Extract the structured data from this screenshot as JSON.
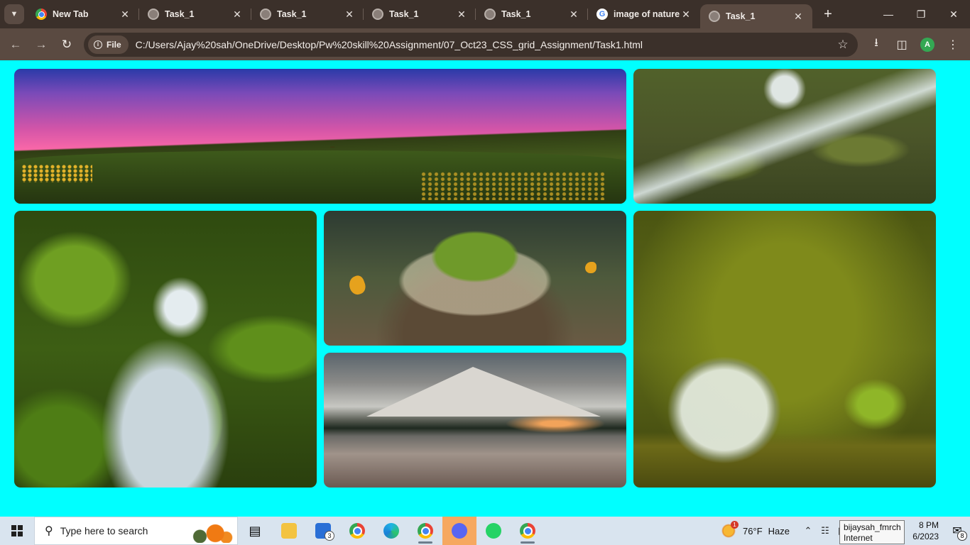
{
  "browser": {
    "tabs": [
      {
        "title": "New Tab",
        "icon": "chrome-icon",
        "active": false
      },
      {
        "title": "Task_1",
        "icon": "globe-icon",
        "active": false
      },
      {
        "title": "Task_1",
        "icon": "globe-icon",
        "active": false
      },
      {
        "title": "Task_1",
        "icon": "globe-icon",
        "active": false
      },
      {
        "title": "Task_1",
        "icon": "globe-icon",
        "active": false
      },
      {
        "title": "image of nature",
        "icon": "google-icon",
        "active": false
      },
      {
        "title": "Task_1",
        "icon": "globe-icon",
        "active": true
      }
    ],
    "site_chip": "File",
    "url": "C:/Users/Ajay%20sah/OneDrive/Desktop/Pw%20skill%20Assignment/07_Oct23_CSS_grid_Assignment/Task1.html",
    "profile_initial": "A",
    "google_letter": "G"
  },
  "page": {
    "background": "#00ffff",
    "images": [
      {
        "name": "pink-sky-meadow-image"
      },
      {
        "name": "waterfall-rocks-image"
      },
      {
        "name": "mossy-waterfall-image"
      },
      {
        "name": "tree-in-glass-globe-image"
      },
      {
        "name": "mountain-lake-reflection-image"
      },
      {
        "name": "glass-globe-on-moss-image"
      }
    ]
  },
  "taskbar": {
    "search_placeholder": "Type here to search",
    "mail_badge": "3",
    "weather_alert": "1",
    "temperature": "76°F",
    "condition": "Haze",
    "time": "8 PM",
    "date": "6/2023",
    "notification_count": "8",
    "tooltip_line1": "bijaysah_fmrch",
    "tooltip_line2": "Internet access"
  }
}
